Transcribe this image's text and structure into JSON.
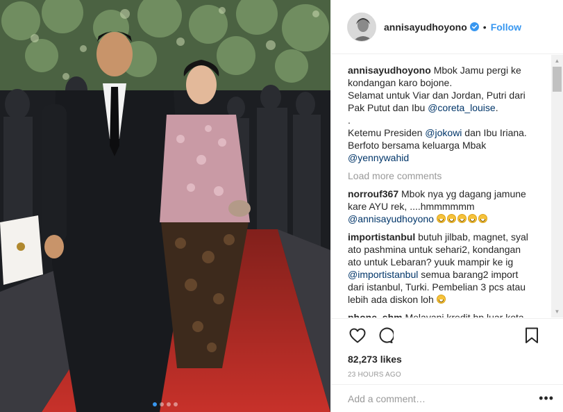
{
  "post": {
    "photo_alt": "Couple walking on red carpet",
    "carousel": {
      "count": 4,
      "active": 0
    }
  },
  "header": {
    "username": "annisayudhoyono",
    "verified": true,
    "separator": "•",
    "follow_label": "Follow"
  },
  "caption": {
    "username": "annisayudhoyono",
    "line1": "Mbok Jamu pergi ke kondangan karo bojone.",
    "line2_pre": "Selamat untuk Viar dan Jordan, Putri dari Pak Putut dan Ibu ",
    "line2_mention": "@coreta_louise",
    "line2_post": ".",
    "line3": ".",
    "line4_pre": "Ketemu Presiden ",
    "line4_mention": "@jokowi",
    "line4_mid": " dan Ibu Iriana. Berfoto bersama keluarga Mbak ",
    "line4_mention2": "@yennywahid"
  },
  "load_more": "Load more comments",
  "comments": [
    {
      "username": "norrouf367",
      "text": "Mbok nya yg dagang jamune kare AYU rek, ....hmmmmmm ",
      "mention": "@annisayudhoyono",
      "emoji_count": 5
    },
    {
      "username": "importistanbul",
      "text_pre": "butuh jilbab, magnet, syal ato pashmina untuk sehari2, kondangan ato untuk Lebaran? yuuk mampir ke ig ",
      "mention": "@importistanbul",
      "text_post": " semua barang2 import dari istanbul, Turki. Pembelian 3 pcs atau lebih ada diskon loh ",
      "emoji_count": 1
    },
    {
      "username": "phone_shm",
      "text": "Melayani kredit hp luar kota"
    }
  ],
  "actions": {
    "icons": [
      "heart-icon",
      "comment-icon",
      "bookmark-icon"
    ],
    "likes": "82,273 likes",
    "time": "23 HOURS AGO"
  },
  "add_comment": {
    "placeholder": "Add a comment…",
    "more": "•••"
  },
  "colors": {
    "accent": "#3897f0",
    "mention": "#003569",
    "muted": "#999999",
    "border": "#efefef"
  }
}
